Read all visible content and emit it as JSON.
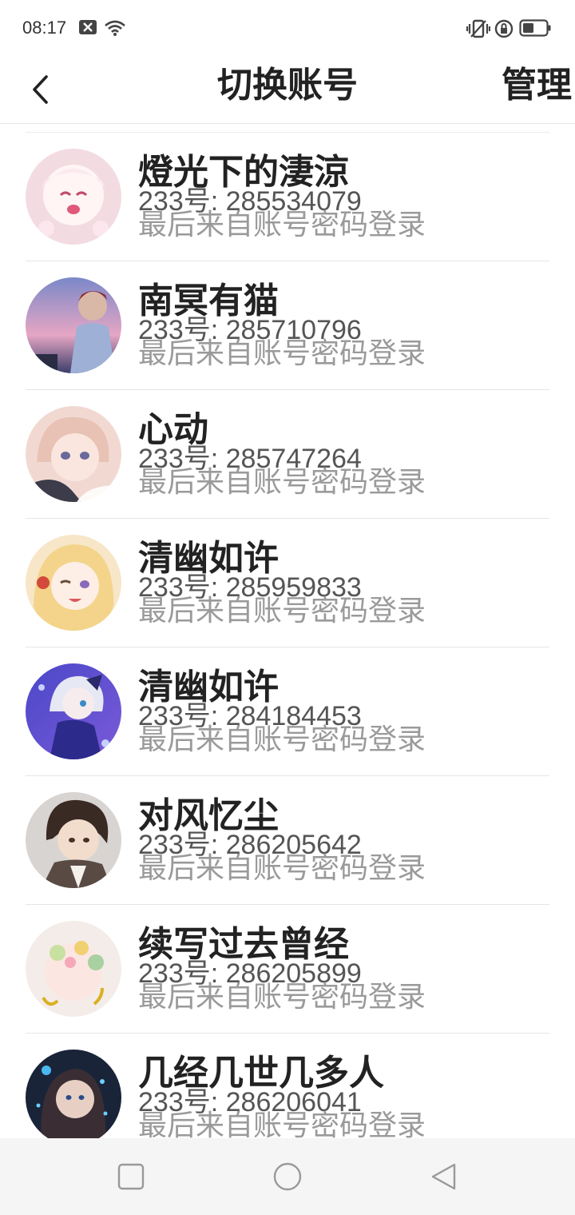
{
  "status_bar": {
    "time": "08:17",
    "icons": [
      "notification-x-icon",
      "wifi-icon",
      "vibrate-icon",
      "rotation-lock-icon",
      "battery-icon"
    ]
  },
  "header": {
    "back_icon": "chevron-left-icon",
    "title": "切换账号",
    "manage_label": "管理"
  },
  "accounts": [
    {
      "nickname": "燈光下的淒涼",
      "uid": "233号: 285534079",
      "login_source": "最后来自账号密码登录"
    },
    {
      "nickname": "南冥有猫",
      "uid": "233号: 285710796",
      "login_source": "最后来自账号密码登录"
    },
    {
      "nickname": "心动",
      "uid": "233号: 285747264",
      "login_source": "最后来自账号密码登录"
    },
    {
      "nickname": "清幽如许",
      "uid": "233号: 285959833",
      "login_source": "最后来自账号密码登录"
    },
    {
      "nickname": "清幽如许",
      "uid": "233号: 284184453",
      "login_source": "最后来自账号密码登录"
    },
    {
      "nickname": "对风忆尘",
      "uid": "233号: 286205642",
      "login_source": "最后来自账号密码登录"
    },
    {
      "nickname": "续写过去曾经",
      "uid": "233号: 286205899",
      "login_source": "最后来自账号密码登录"
    },
    {
      "nickname": "几经几世几多人",
      "uid": "233号: 286206041",
      "login_source": "最后来自账号密码登录"
    }
  ],
  "nav_bar": {
    "icons": [
      "recent-apps-square-icon",
      "home-circle-icon",
      "back-triangle-icon"
    ]
  },
  "colors": {
    "title_text": "#222222",
    "uid_text": "#555555",
    "secondary_text": "#9a9a9a",
    "divider": "#e6e6e6",
    "nav_bg": "#f5f5f5"
  }
}
